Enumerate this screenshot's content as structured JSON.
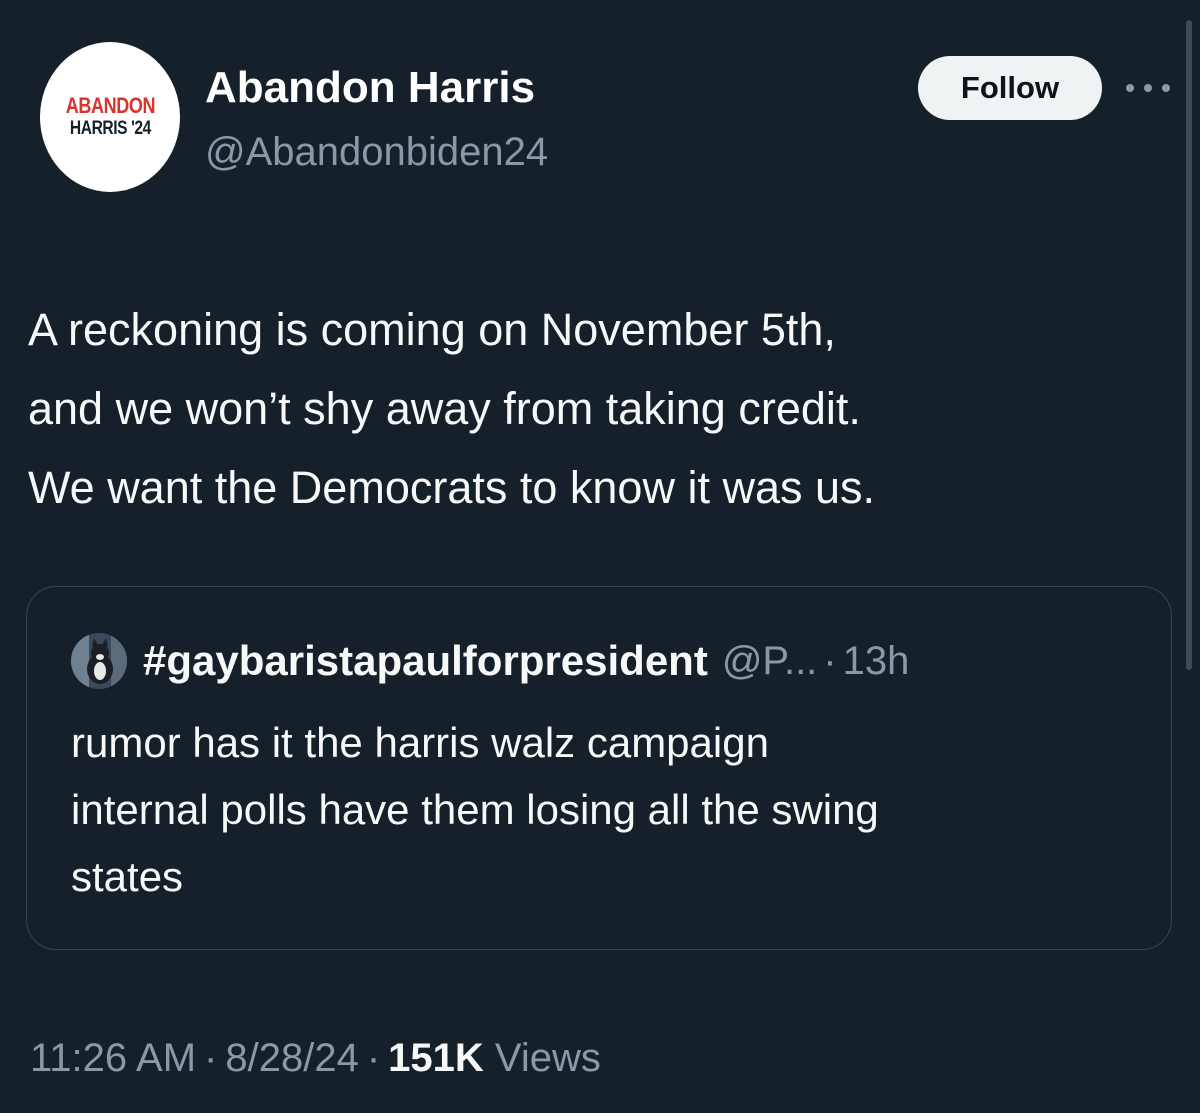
{
  "author": {
    "avatar_logo": {
      "line1": "ABANDON",
      "line2": "HARRIS '24"
    },
    "display_name": "Abandon Harris",
    "handle": "@Abandonbiden24"
  },
  "actions": {
    "follow_label": "Follow",
    "more_icon": "more-horizontal-icon"
  },
  "tweet": {
    "text_lines": [
      "A reckoning is coming on November 5th,",
      "and we won’t shy away from taking credit.",
      "We want the Democrats to know it was us."
    ]
  },
  "quoted_tweet": {
    "display_name": "#gaybaristapaulforpresident",
    "handle": "@P...",
    "separator": "·",
    "time": "13h",
    "text_lines": [
      "rumor has it the harris walz campaign",
      "internal polls have them losing all the swing",
      "states"
    ]
  },
  "meta": {
    "time": "11:26 AM",
    "separator": "·",
    "date": "8/28/24",
    "views_count": "151K",
    "views_label": "Views"
  },
  "colors": {
    "background": "#15202b",
    "secondary_text": "#8b98a5",
    "logo_red": "#d9342b",
    "button_bg": "#eff3f4"
  }
}
